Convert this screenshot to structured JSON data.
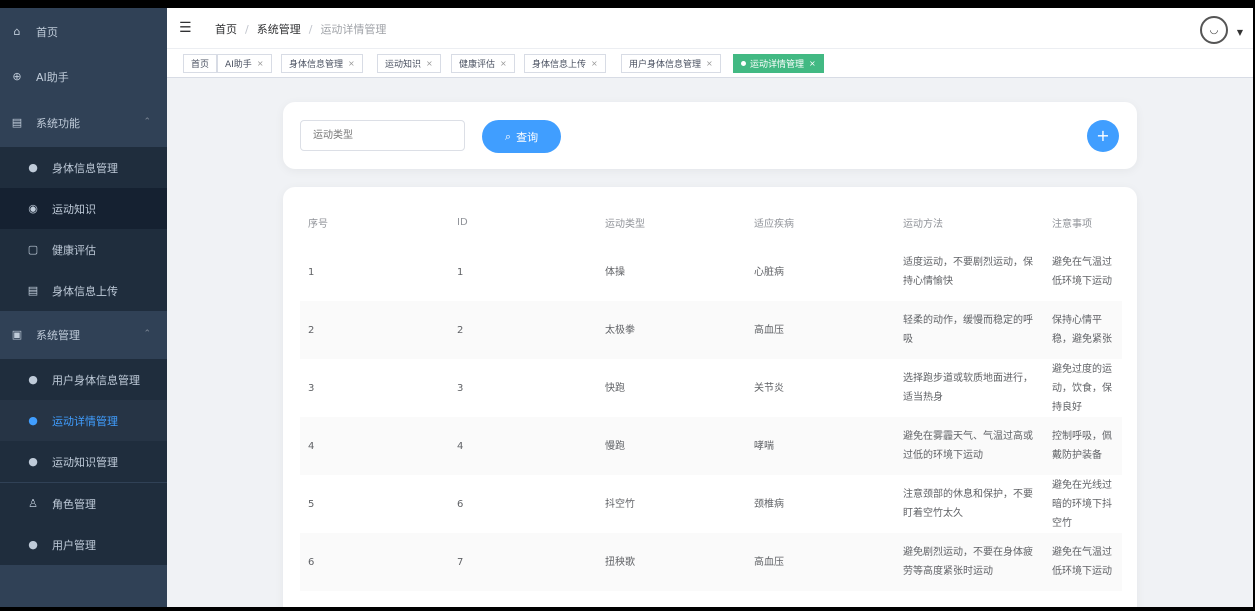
{
  "sidebar": {
    "items": [
      {
        "label": "首页",
        "icon": "home-icon"
      },
      {
        "label": "AI助手",
        "icon": "plus-circle-icon"
      },
      {
        "label": "系统功能",
        "icon": "document-icon"
      },
      {
        "label": "身体信息管理",
        "icon": "user-icon"
      },
      {
        "label": "运动知识",
        "icon": "location-icon"
      },
      {
        "label": "健康评估",
        "icon": "calendar-icon"
      },
      {
        "label": "身体信息上传",
        "icon": "document-icon"
      },
      {
        "label": "系统管理",
        "icon": "briefcase-icon"
      },
      {
        "label": "用户身体信息管理",
        "icon": "user-icon"
      },
      {
        "label": "运动详情管理",
        "icon": "user-icon"
      },
      {
        "label": "运动知识管理",
        "icon": "user-icon"
      },
      {
        "label": "角色管理",
        "icon": "person-outline-icon"
      },
      {
        "label": "用户管理",
        "icon": "user-icon"
      }
    ]
  },
  "header": {
    "breadcrumb": [
      "首页",
      "系统管理",
      "运动详情管理"
    ]
  },
  "tags": [
    {
      "label": "首页"
    },
    {
      "label": "AI助手"
    },
    {
      "label": "身体信息管理"
    },
    {
      "label": "运动知识"
    },
    {
      "label": "健康评估"
    },
    {
      "label": "身体信息上传"
    },
    {
      "label": "用户身体信息管理"
    },
    {
      "label": "运动详情管理"
    }
  ],
  "search": {
    "placeholder": "运动类型",
    "button_label": "查询",
    "add_label": "+"
  },
  "table": {
    "columns": [
      "序号",
      "ID",
      "运动类型",
      "适应疾病",
      "运动方法",
      "注意事项"
    ],
    "rows": [
      [
        "1",
        "1",
        "体操",
        "心脏病",
        "适度运动，不要剧烈运动，保持心情愉快",
        "避免在气温过低环境下运动"
      ],
      [
        "2",
        "2",
        "太极拳",
        "高血压",
        "轻柔的动作，缓慢而稳定的呼吸",
        "保持心情平稳，避免紧张"
      ],
      [
        "3",
        "3",
        "快跑",
        "关节炎",
        "选择跑步道或软质地面进行，适当热身",
        "避免过度的运动，饮食，保持良好"
      ],
      [
        "4",
        "4",
        "慢跑",
        "哮喘",
        "避免在雾霾天气、气温过高或过低的环境下运动",
        "控制呼吸，佩戴防护装备"
      ],
      [
        "5",
        "6",
        "抖空竹",
        "颈椎病",
        "注意颈部的休息和保护，不要盯着空竹太久",
        "避免在光线过暗的环境下抖空竹"
      ],
      [
        "6",
        "7",
        "扭秧歌",
        "高血压",
        "避免剧烈运动，不要在身体疲劳等高度紧张时运动",
        "避免在气温过低环境下运动"
      ]
    ]
  },
  "colors": {
    "sidebar_bg": "#304156",
    "primary": "#409eff",
    "active_tag": "#42b983"
  }
}
